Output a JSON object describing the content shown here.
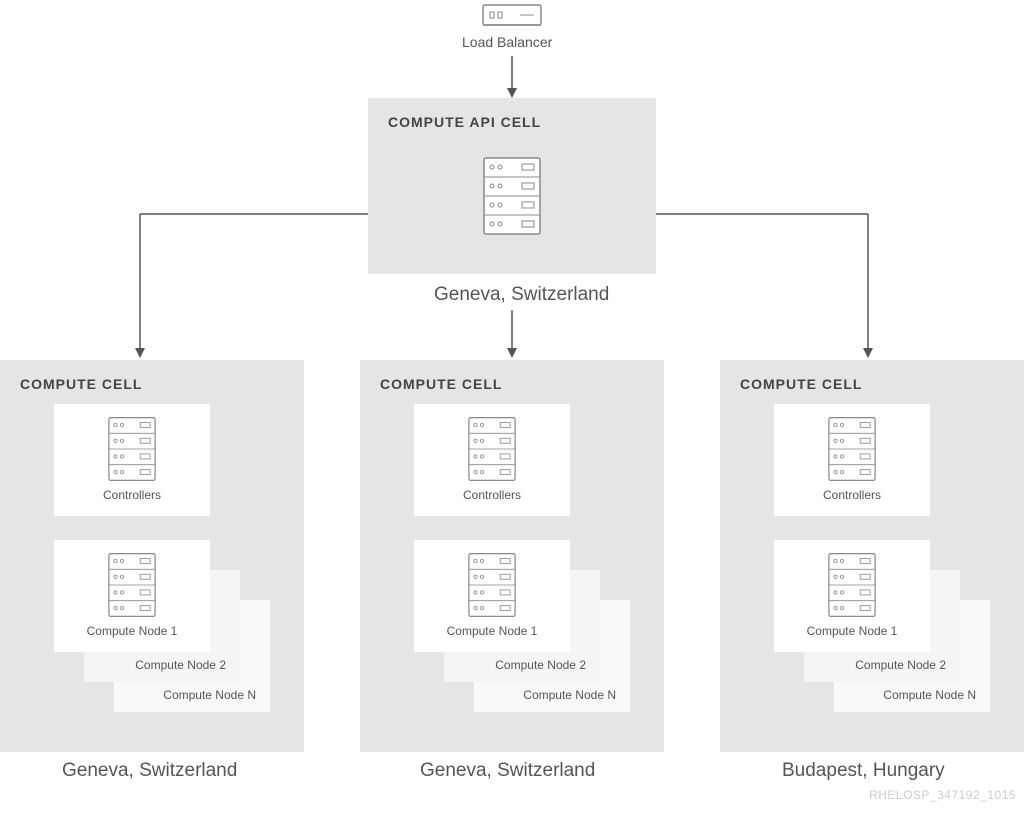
{
  "loadBalancer": {
    "label": "Load Balancer"
  },
  "apiCell": {
    "title": "COMPUTE API CELL",
    "location": "Geneva, Switzerland"
  },
  "cells": {
    "title": "COMPUTE CELL",
    "controllers": "Controllers",
    "node1": "Compute Node 1",
    "node2": "Compute Node 2",
    "nodeN": "Compute Node N",
    "loc": {
      "a": "Geneva, Switzerland",
      "b": "Geneva, Switzerland",
      "c": "Budapest, Hungary"
    }
  },
  "footer": "RHELOSP_347192_1015"
}
